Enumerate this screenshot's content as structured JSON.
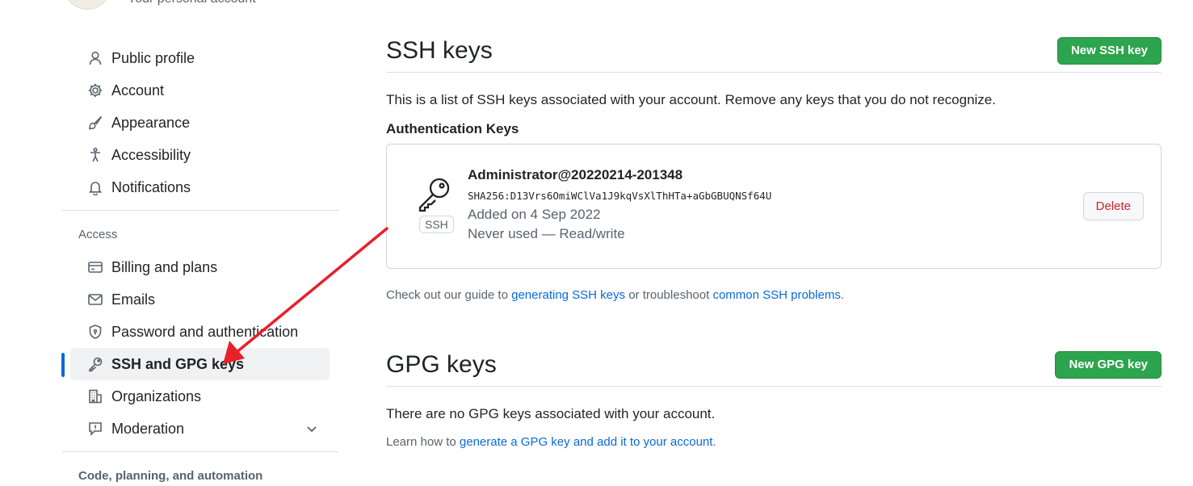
{
  "header": {
    "subtitle": "Your personal account"
  },
  "sidebar": {
    "items": [
      {
        "label": "Public profile",
        "icon": "person-icon"
      },
      {
        "label": "Account",
        "icon": "gear-icon"
      },
      {
        "label": "Appearance",
        "icon": "paintbrush-icon"
      },
      {
        "label": "Accessibility",
        "icon": "accessibility-icon"
      },
      {
        "label": "Notifications",
        "icon": "bell-icon"
      }
    ],
    "access_label": "Access",
    "access_items": [
      {
        "label": "Billing and plans",
        "icon": "credit-card-icon"
      },
      {
        "label": "Emails",
        "icon": "mail-icon"
      },
      {
        "label": "Password and authentication",
        "icon": "shield-lock-icon"
      },
      {
        "label": "SSH and GPG keys",
        "icon": "key-icon",
        "active": true
      },
      {
        "label": "Organizations",
        "icon": "organization-icon"
      },
      {
        "label": "Moderation",
        "icon": "report-icon"
      }
    ],
    "code_label": "Code, planning, and automation"
  },
  "ssh": {
    "title": "SSH keys",
    "new_button": "New SSH key",
    "description": "This is a list of SSH keys associated with your account. Remove any keys that you do not recognize.",
    "auth_label": "Authentication Keys",
    "key": {
      "badge": "SSH",
      "name": "Administrator@20220214-201348",
      "fingerprint": "SHA256:D13Vrs6OmiWClVa1J9kqVsXlThHTa+aGbGBUQNSf64U",
      "added": "Added on 4 Sep 2022",
      "usage": "Never used — Read/write",
      "delete_button": "Delete"
    },
    "guide_prefix": "Check out our guide to ",
    "guide_link1": "generating SSH keys",
    "guide_mid": " or troubleshoot ",
    "guide_link2": "common SSH problems",
    "guide_suffix": "."
  },
  "gpg": {
    "title": "GPG keys",
    "new_button": "New GPG key",
    "none_text": "There are no GPG keys associated with your account.",
    "learn_prefix": "Learn how to ",
    "learn_link": "generate a GPG key and add it to your account",
    "learn_suffix": "."
  },
  "colors": {
    "accent": "#0969da",
    "primary_button": "#2da44e",
    "danger": "#cf222e",
    "annotation": "#e8202a"
  }
}
